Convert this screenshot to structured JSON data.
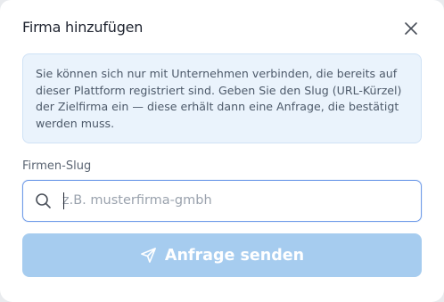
{
  "dialog": {
    "title": "Firma hinzufügen",
    "close_icon": "close-icon"
  },
  "info": {
    "text": "Sie können sich nur mit Unternehmen verbinden, die bereits auf dieser Plattform registriert sind. Geben Sie den Slug (URL-Kürzel) der Zielfirma ein — diese erhält dann eine Anfrage, die bestätigt werden muss."
  },
  "slug_field": {
    "label": "Firmen-Slug",
    "value": "",
    "placeholder": "z.B. musterfirma-gmbh",
    "icon": "search-icon"
  },
  "submit": {
    "label": "Anfrage senden",
    "icon": "send-icon",
    "state": "disabled"
  },
  "colors": {
    "info_bg": "#eaf3fc",
    "info_border": "#cfe2f6",
    "input_border_focus": "#6f9be8",
    "button_disabled": "#a6ccef",
    "title_text": "#1f2430"
  }
}
